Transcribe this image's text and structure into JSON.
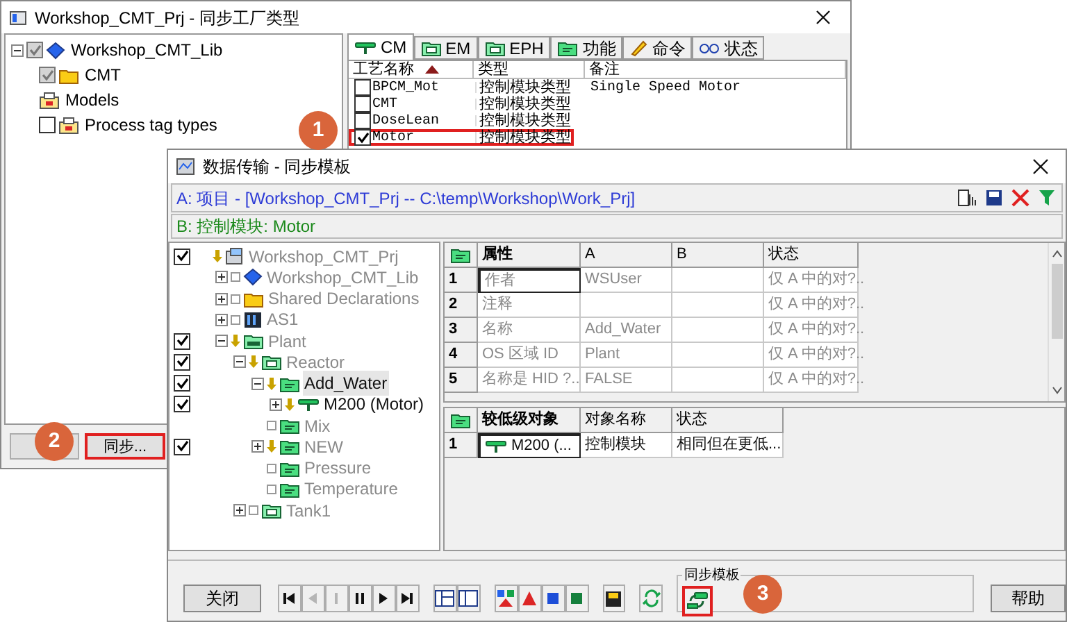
{
  "plant_window": {
    "title": "Workshop_CMT_Prj - 同步工厂类型",
    "tree": [
      {
        "label": "Workshop_CMT_Lib",
        "kind": "library",
        "checked": true,
        "disabled": true,
        "expanded": true,
        "children": [
          {
            "label": "CMT",
            "kind": "folder",
            "checked": true,
            "disabled": true
          },
          {
            "label": "Models",
            "kind": "models"
          },
          {
            "label": "Process tag types",
            "kind": "models",
            "checked": false,
            "disabled": false
          }
        ]
      }
    ],
    "tabs": [
      {
        "label": "CM",
        "kind": "cm",
        "selected": true
      },
      {
        "label": "EM",
        "kind": "unit",
        "selected": false
      },
      {
        "label": "EPH",
        "kind": "unit",
        "selected": false
      },
      {
        "label": "功能",
        "kind": "function",
        "selected": false
      },
      {
        "label": "命令",
        "kind": "pen",
        "selected": false
      },
      {
        "label": "状态",
        "kind": "state",
        "selected": false
      }
    ],
    "table": {
      "columns": [
        {
          "label": "工艺名称",
          "sorted": true
        },
        {
          "label": "类型",
          "sorted": false
        },
        {
          "label": "备注",
          "sorted": false
        }
      ],
      "rows": [
        {
          "checked": false,
          "highlighted": false,
          "cells": [
            "BPCM_Mot",
            "控制模块类型",
            "Single Speed Motor"
          ]
        },
        {
          "checked": false,
          "highlighted": false,
          "cells": [
            "CMT",
            "控制模块类型",
            ""
          ]
        },
        {
          "checked": false,
          "highlighted": false,
          "cells": [
            "DoseLean",
            "控制模块类型",
            ""
          ]
        },
        {
          "checked": true,
          "highlighted": true,
          "cells": [
            "Motor",
            "控制模块类型",
            ""
          ]
        }
      ]
    },
    "sync_button": {
      "label": "同步...",
      "highlighted": true
    }
  },
  "transfer_window": {
    "title": "数据传输 - 同步模板",
    "source": "A: 项目 - [Workshop_CMT_Prj -- C:\\temp\\Workshop\\Work_Prj]",
    "target": "B: 控制模块: Motor",
    "tree": [
      {
        "label": "Workshop_CMT_Prj",
        "kind": "project",
        "checked": true,
        "marked": true,
        "dimmed": true,
        "selected": false,
        "children": [
          {
            "label": "Workshop_CMT_Lib",
            "kind": "library",
            "checked": false,
            "marked": false,
            "dimmed": true,
            "selected": false,
            "expanded": false
          },
          {
            "label": "Shared Declarations",
            "kind": "folder",
            "checked": false,
            "marked": false,
            "dimmed": true,
            "selected": false,
            "expanded": false
          },
          {
            "label": "AS1",
            "kind": "station",
            "checked": false,
            "marked": false,
            "dimmed": true,
            "selected": false,
            "expanded": false
          },
          {
            "label": "Plant",
            "kind": "plant",
            "checked": true,
            "marked": true,
            "dimmed": true,
            "selected": false,
            "expanded": true,
            "children": [
              {
                "label": "Reactor",
                "kind": "unit",
                "checked": true,
                "marked": true,
                "dimmed": true,
                "selected": false,
                "expanded": true,
                "children": [
                  {
                    "label": "Add_Water",
                    "kind": "function",
                    "checked": true,
                    "marked": true,
                    "dimmed": false,
                    "selected": true,
                    "expanded": true,
                    "children": [
                      {
                        "label": "M200  (Motor)",
                        "kind": "cm",
                        "checked": true,
                        "marked": true,
                        "dimmed": false,
                        "selected": false,
                        "expanded": false
                      }
                    ]
                  },
                  {
                    "label": "Mix",
                    "kind": "function",
                    "checked": false,
                    "marked": false,
                    "dimmed": true,
                    "selected": false
                  },
                  {
                    "label": "NEW",
                    "kind": "function",
                    "checked": true,
                    "marked": true,
                    "dimmed": true,
                    "selected": false,
                    "expanded": false
                  },
                  {
                    "label": "Pressure",
                    "kind": "function",
                    "checked": false,
                    "marked": false,
                    "dimmed": true,
                    "selected": false
                  },
                  {
                    "label": "Temperature",
                    "kind": "function",
                    "checked": false,
                    "marked": false,
                    "dimmed": true,
                    "selected": false
                  }
                ]
              },
              {
                "label": "Tank1",
                "kind": "unit",
                "checked": false,
                "marked": false,
                "dimmed": true,
                "selected": false,
                "expanded": false
              }
            ]
          }
        ]
      }
    ],
    "properties": {
      "columns": [
        "属性",
        "A",
        "B",
        "状态"
      ],
      "rows": [
        {
          "number": "1",
          "focused": true,
          "cells": [
            "作者",
            "WSUser",
            "",
            "仅 A 中的对?.."
          ]
        },
        {
          "number": "2",
          "focused": false,
          "cells": [
            "注释",
            "",
            "",
            "仅 A 中的对?.."
          ]
        },
        {
          "number": "3",
          "focused": false,
          "cells": [
            "名称",
            "Add_Water",
            "",
            "仅 A 中的对?.."
          ]
        },
        {
          "number": "4",
          "focused": false,
          "cells": [
            "OS 区域 ID",
            "Plant",
            "",
            "仅 A 中的对?.."
          ]
        },
        {
          "number": "5",
          "focused": false,
          "cells": [
            "名称是 HID ?..",
            "FALSE",
            "",
            "仅 A 中的对?.."
          ]
        }
      ]
    },
    "lower_objects": {
      "columns": [
        "较低级对象",
        "对象名称",
        "状态"
      ],
      "rows": [
        {
          "number": "1",
          "focused": true,
          "cells": [
            "M200  (...",
            "控制模块",
            "相同但在更低..."
          ]
        }
      ]
    },
    "close_button": "关闭",
    "nav_buttons": [
      {
        "kind": "first",
        "disabled": false
      },
      {
        "kind": "prev",
        "disabled": true
      },
      {
        "kind": "stop",
        "disabled": true
      },
      {
        "kind": "pause",
        "disabled": false
      },
      {
        "kind": "next",
        "disabled": false
      },
      {
        "kind": "last",
        "disabled": false
      }
    ],
    "group_title": "同步模板",
    "sync_template_button": {
      "highlighted": true
    },
    "help_button": "帮助"
  },
  "callouts": [
    "1",
    "2",
    "3"
  ]
}
